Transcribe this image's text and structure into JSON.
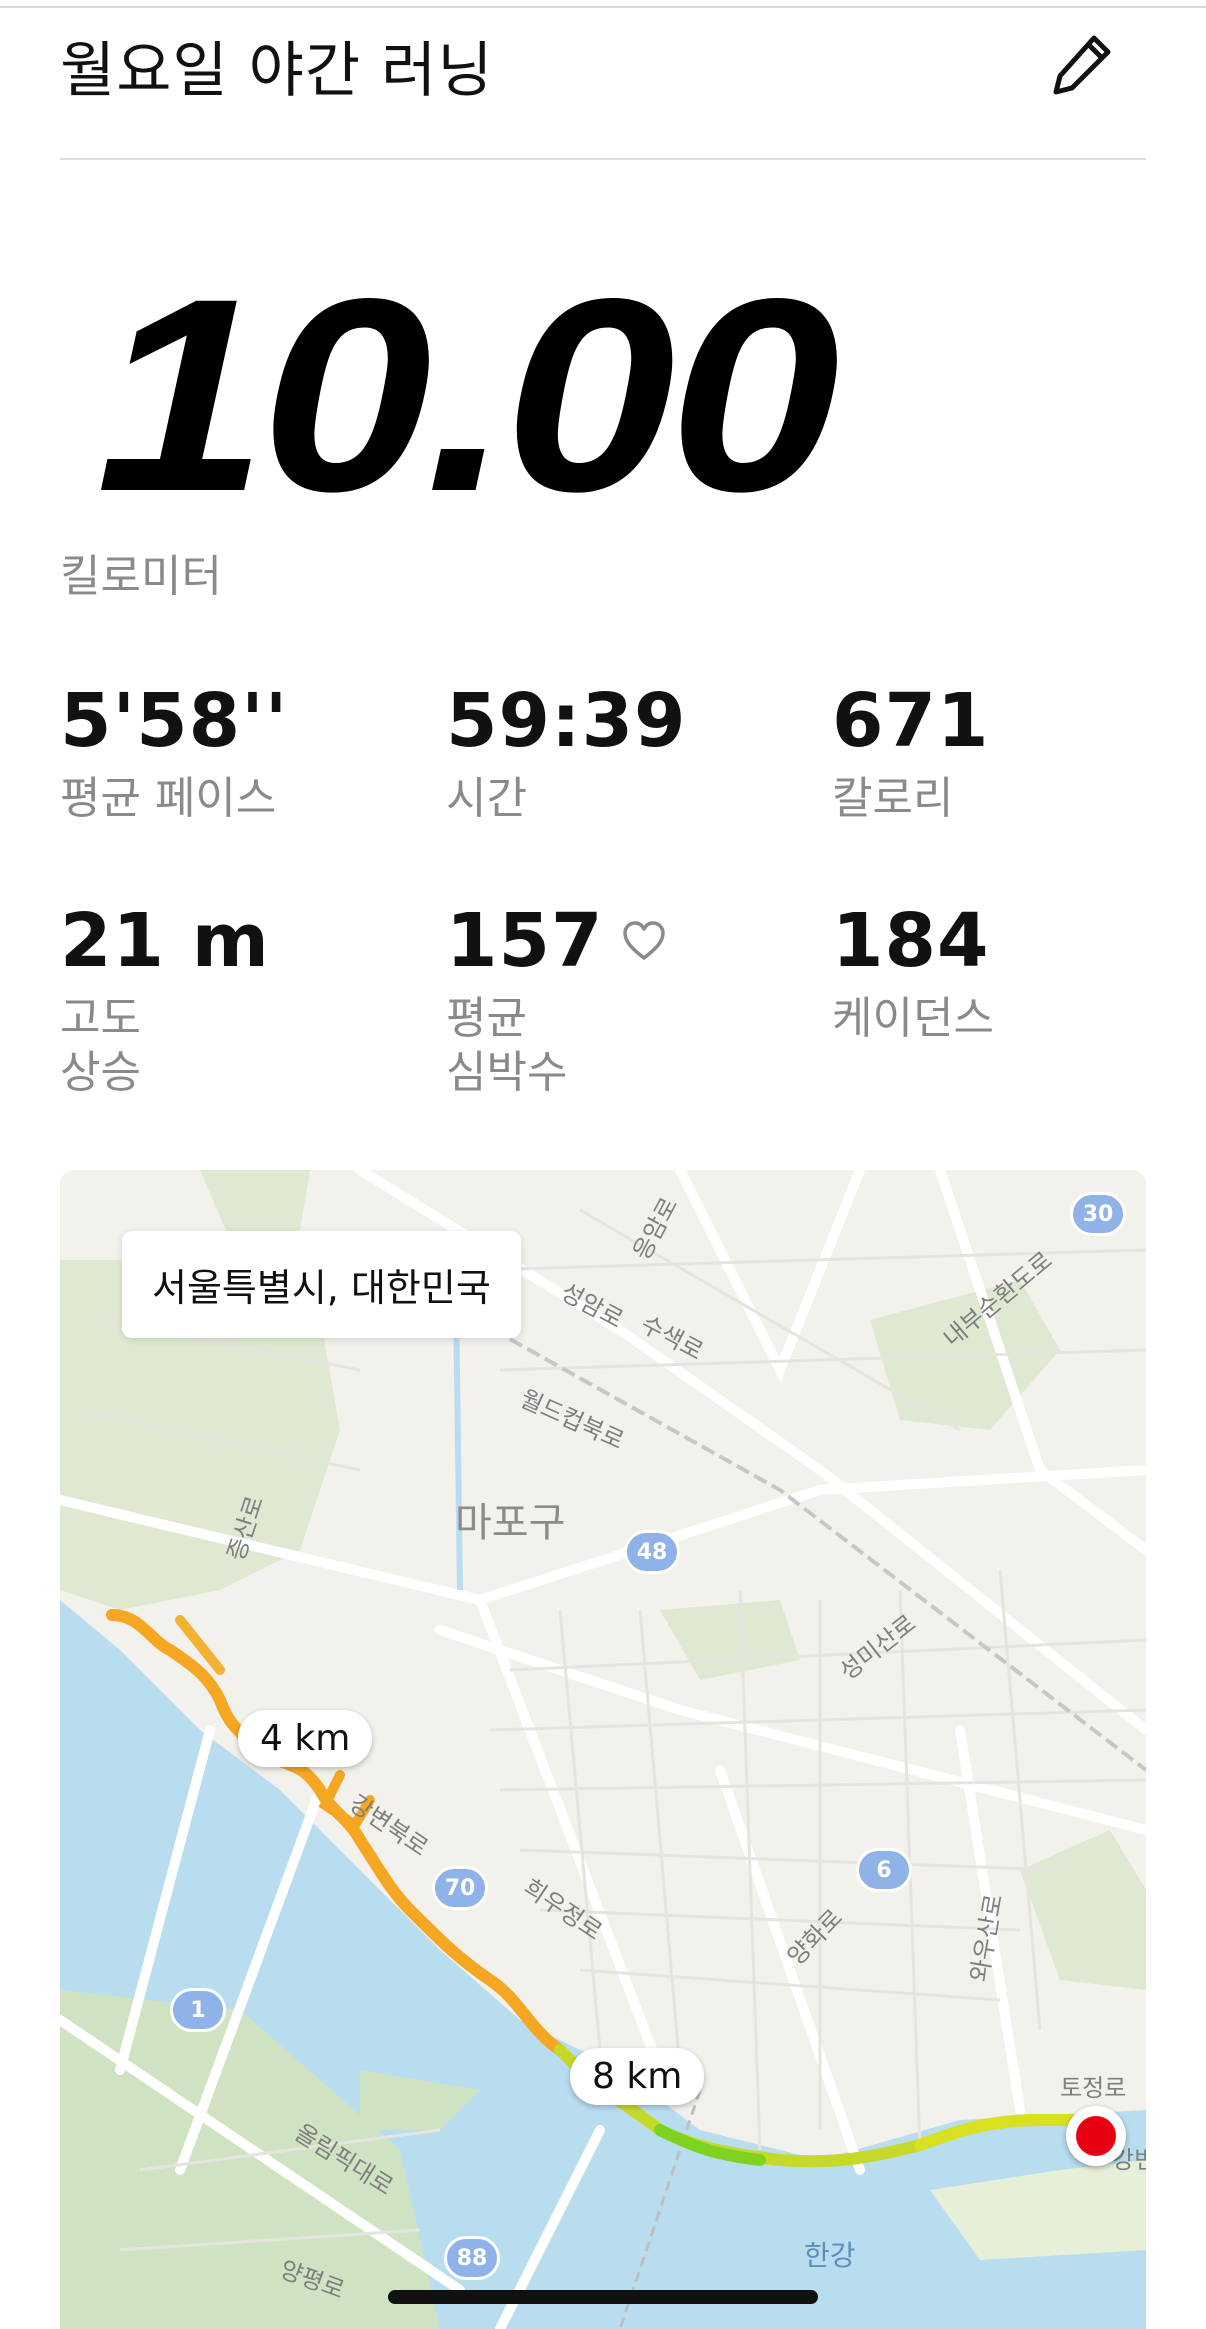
{
  "header": {
    "title": "월요일 야간 러닝",
    "edit_icon": "pencil-icon"
  },
  "summary": {
    "distance": "10.00",
    "distance_unit": "킬로미터"
  },
  "stats": [
    {
      "value": "5'58''",
      "label": "평균 페이스"
    },
    {
      "value": "59:39",
      "label": "시간"
    },
    {
      "value": "671",
      "label": "칼로리"
    },
    {
      "value": "21 m",
      "label_line1": "고도",
      "label_line2": "상승"
    },
    {
      "value": "157",
      "label_line1": "평균",
      "label_line2": "심박수",
      "icon": "heart-icon"
    },
    {
      "value": "184",
      "label": "케이던스"
    }
  ],
  "map": {
    "location": "서울특별시, 대한민국",
    "district": "마포구",
    "roads": [
      "성암로",
      "수색로",
      "월드컵북로",
      "증산로",
      "성미산로",
      "강변북로",
      "희우정로",
      "양화로",
      "와우산로",
      "올림픽대로",
      "양평로",
      "내부순환도로",
      "응암로",
      "토정로",
      "강변"
    ],
    "river": "한강",
    "route_numbers": [
      "30",
      "48",
      "70",
      "6",
      "1",
      "88"
    ],
    "km_markers": [
      "4 km",
      "8 km"
    ],
    "route_colors": {
      "start": "#f5a623",
      "mid": "#f5c518",
      "end": "#7ed321"
    },
    "end_pin_color": "#e60012"
  }
}
